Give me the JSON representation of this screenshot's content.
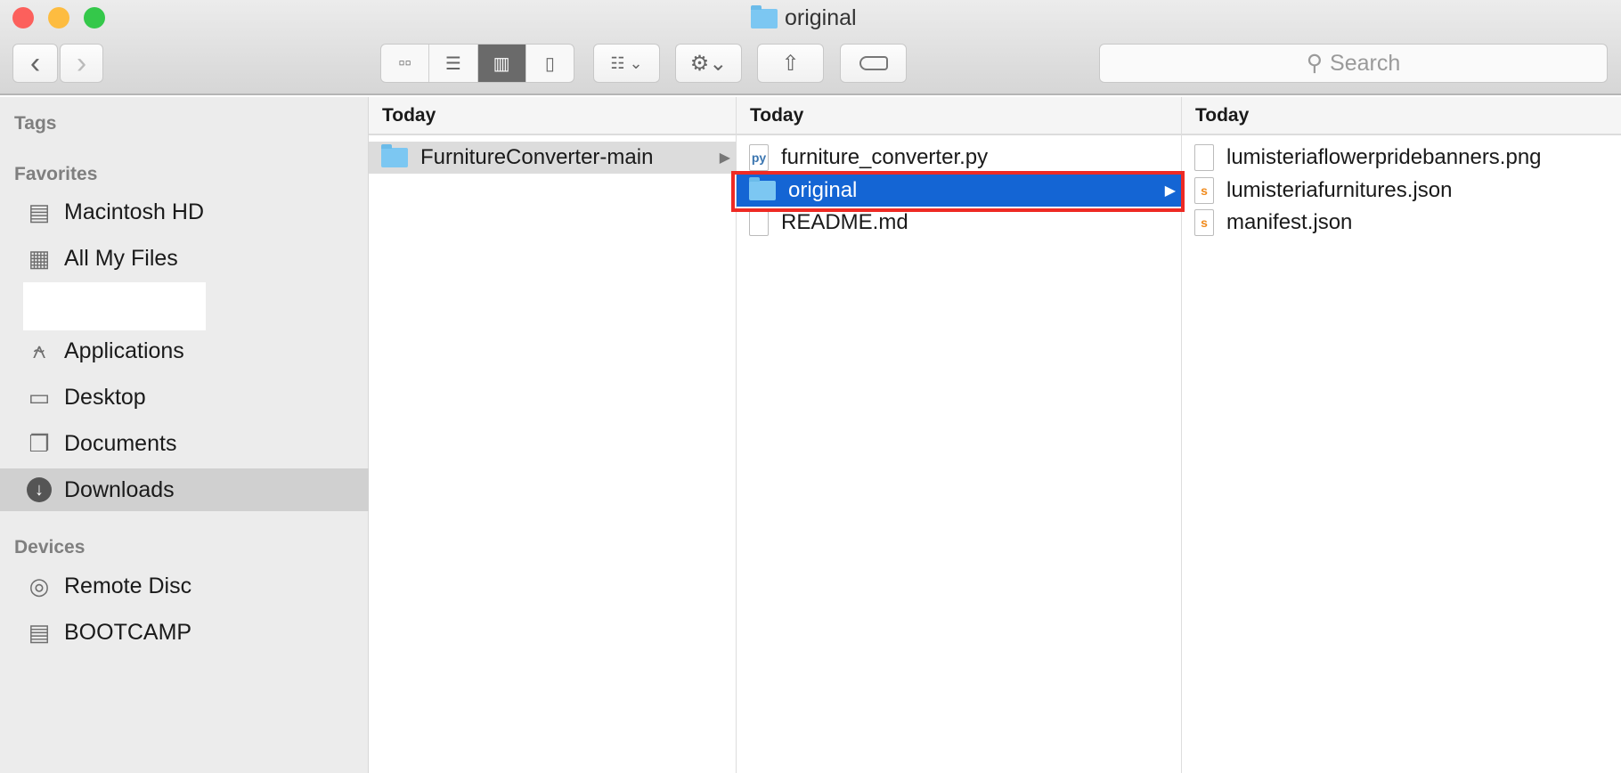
{
  "window": {
    "title": "original"
  },
  "toolbar": {
    "back": "‹",
    "forward": "›",
    "search_placeholder": "Search"
  },
  "sidebar": {
    "tags_header": "Tags",
    "favorites_header": "Favorites",
    "devices_header": "Devices",
    "favorites": [
      {
        "label": "Macintosh HD",
        "icon": "hard-drive-icon"
      },
      {
        "label": "All My Files",
        "icon": "all-files-icon"
      },
      {
        "label": "Applications",
        "icon": "applications-icon"
      },
      {
        "label": "Desktop",
        "icon": "desktop-icon"
      },
      {
        "label": "Documents",
        "icon": "documents-icon"
      },
      {
        "label": "Downloads",
        "icon": "downloads-icon",
        "selected": true
      }
    ],
    "devices": [
      {
        "label": "Remote Disc",
        "icon": "disc-icon"
      },
      {
        "label": "BOOTCAMP",
        "icon": "hard-drive-icon"
      }
    ]
  },
  "columns": [
    {
      "header": "Today",
      "items": [
        {
          "name": "FurnitureConverter-main",
          "type": "folder"
        }
      ]
    },
    {
      "header": "Today",
      "items": [
        {
          "name": "furniture_converter.py",
          "type": "python"
        },
        {
          "name": "original",
          "type": "folder",
          "selected": true
        },
        {
          "name": "README.md",
          "type": "file"
        }
      ]
    },
    {
      "header": "Today",
      "items": [
        {
          "name": "lumisteriaflowerpridebanners.png",
          "type": "image"
        },
        {
          "name": "lumisteriafurnitures.json",
          "type": "json"
        },
        {
          "name": "manifest.json",
          "type": "json"
        }
      ]
    }
  ],
  "colors": {
    "selection": "#1465d4",
    "highlight_box": "#ee2a24"
  }
}
